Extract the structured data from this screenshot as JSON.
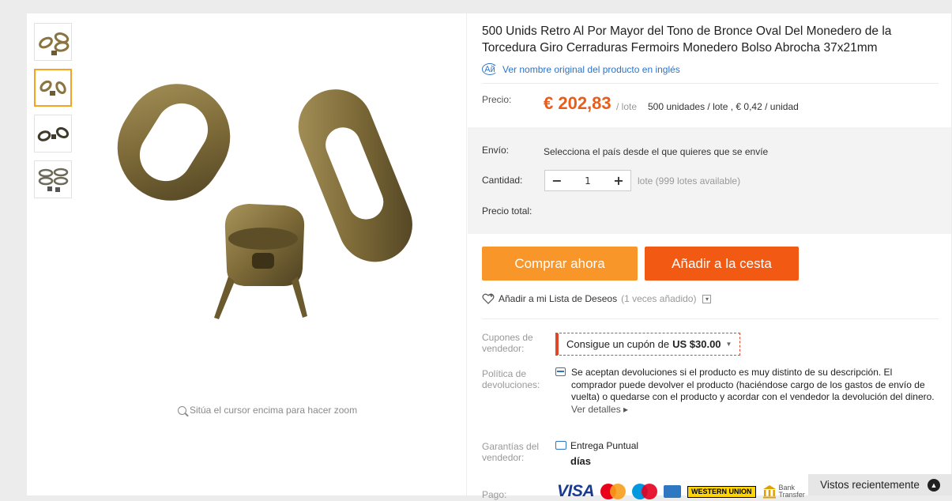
{
  "product": {
    "title": "500 Unids Retro Al Por Mayor del Tono de Bronce Oval Del Monedero de la Torcedura Giro Cerraduras Fermoirs Monedero Bolso Abrocha 37x21mm",
    "original_name_link": "Ver nombre original del producto en inglés",
    "zoom_hint": "Sitúa el cursor encima para hacer zoom"
  },
  "price": {
    "label": "Precio:",
    "value": "€ 202,83",
    "unit": "/ lote",
    "detail": "500 unidades / lote , € 0,42 / unidad"
  },
  "shipping": {
    "label": "Envío:",
    "value": "Selecciona el país desde el que quieres que se envíe"
  },
  "quantity": {
    "label": "Cantidad:",
    "minus": "−",
    "value": "1",
    "plus": "+",
    "note": "lote (999 lotes available)"
  },
  "total": {
    "label": "Precio total:"
  },
  "buttons": {
    "buy_now": "Comprar ahora",
    "add_to_cart": "Añadir a la cesta"
  },
  "wishlist": {
    "label": "Añadir a mi Lista de Deseos",
    "count": "(1 veces añadido)"
  },
  "coupon": {
    "label_line1": "Cupones de",
    "label_line2": "vendedor:",
    "text": "Consigue un cupón de",
    "amount": "US $30.00"
  },
  "returns": {
    "label_line1": "Política de",
    "label_line2": "devoluciones:",
    "text": "Se aceptan devoluciones si el producto es muy distinto de su descripción. El comprador puede devolver el producto (haciéndose cargo de los gastos de envío de vuelta) o quedarse con el producto y acordar con el vendedor la devolución del dinero.",
    "more": "Ver detalles ▸"
  },
  "guarantee": {
    "label_line1": "Garantías del",
    "label_line2": "vendedor:",
    "line1": "Entrega Puntual",
    "line2": "días"
  },
  "payment": {
    "label": "Pago:",
    "visa": "VISA",
    "western_union": "WESTERN UNION",
    "bank_line1": "Bank",
    "bank_line2": "Transfer"
  },
  "recently_viewed": {
    "label": "Vistos recientemente"
  },
  "colors": {
    "price": "#e65d1c",
    "buy_now": "#f9962a",
    "add_to_cart": "#f25a14",
    "link": "#2f73c6",
    "thumb_active": "#f6a223"
  }
}
